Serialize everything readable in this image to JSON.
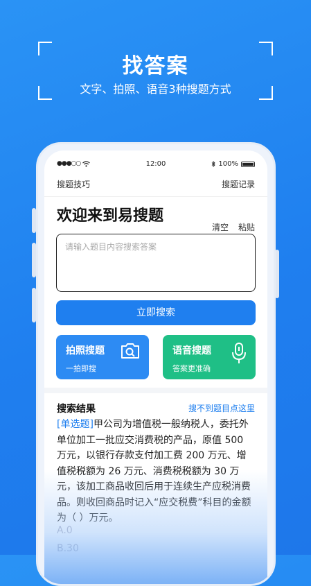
{
  "hero": {
    "title": "找答案",
    "subtitle": "文字、拍照、语音3种搜题方式"
  },
  "status_bar": {
    "signal": "●●●○○",
    "time": "12:00",
    "battery": "100%"
  },
  "top_nav": {
    "left": "搜题技巧",
    "right": "搜题记录"
  },
  "welcome": "欢迎来到易搜题",
  "actions": {
    "clear": "清空",
    "paste": "粘贴"
  },
  "search": {
    "placeholder": "请输入题目内容搜索答案",
    "button": "立即搜索"
  },
  "cards": {
    "photo": {
      "title": "拍照搜题",
      "subtitle": "一拍即搜",
      "icon": "camera-search-icon"
    },
    "voice": {
      "title": "语音搜题",
      "subtitle": "答案更准确",
      "icon": "microphone-icon"
    }
  },
  "results": {
    "title": "搜索结果",
    "link": "搜不到题目点这里",
    "question_tag": "[单选题]",
    "question_text": "甲公司为增值税一般纳税人，委托外单位加工一批应交消费税的产品，原值 500 万元，以银行存款支付加工费 200 万元、增值税税额为 26 万元、消费税税额为 30 万元，该加工商品收回后用于连续生产应税消费品。则收回商品时记入“应交税费”科目的金额为（ ）万元。",
    "options": [
      "A.0",
      "B.30"
    ]
  },
  "colors": {
    "brand_blue": "#1f7fef",
    "voice_green": "#1fbf86",
    "photo_blue": "#2d8bf3"
  }
}
